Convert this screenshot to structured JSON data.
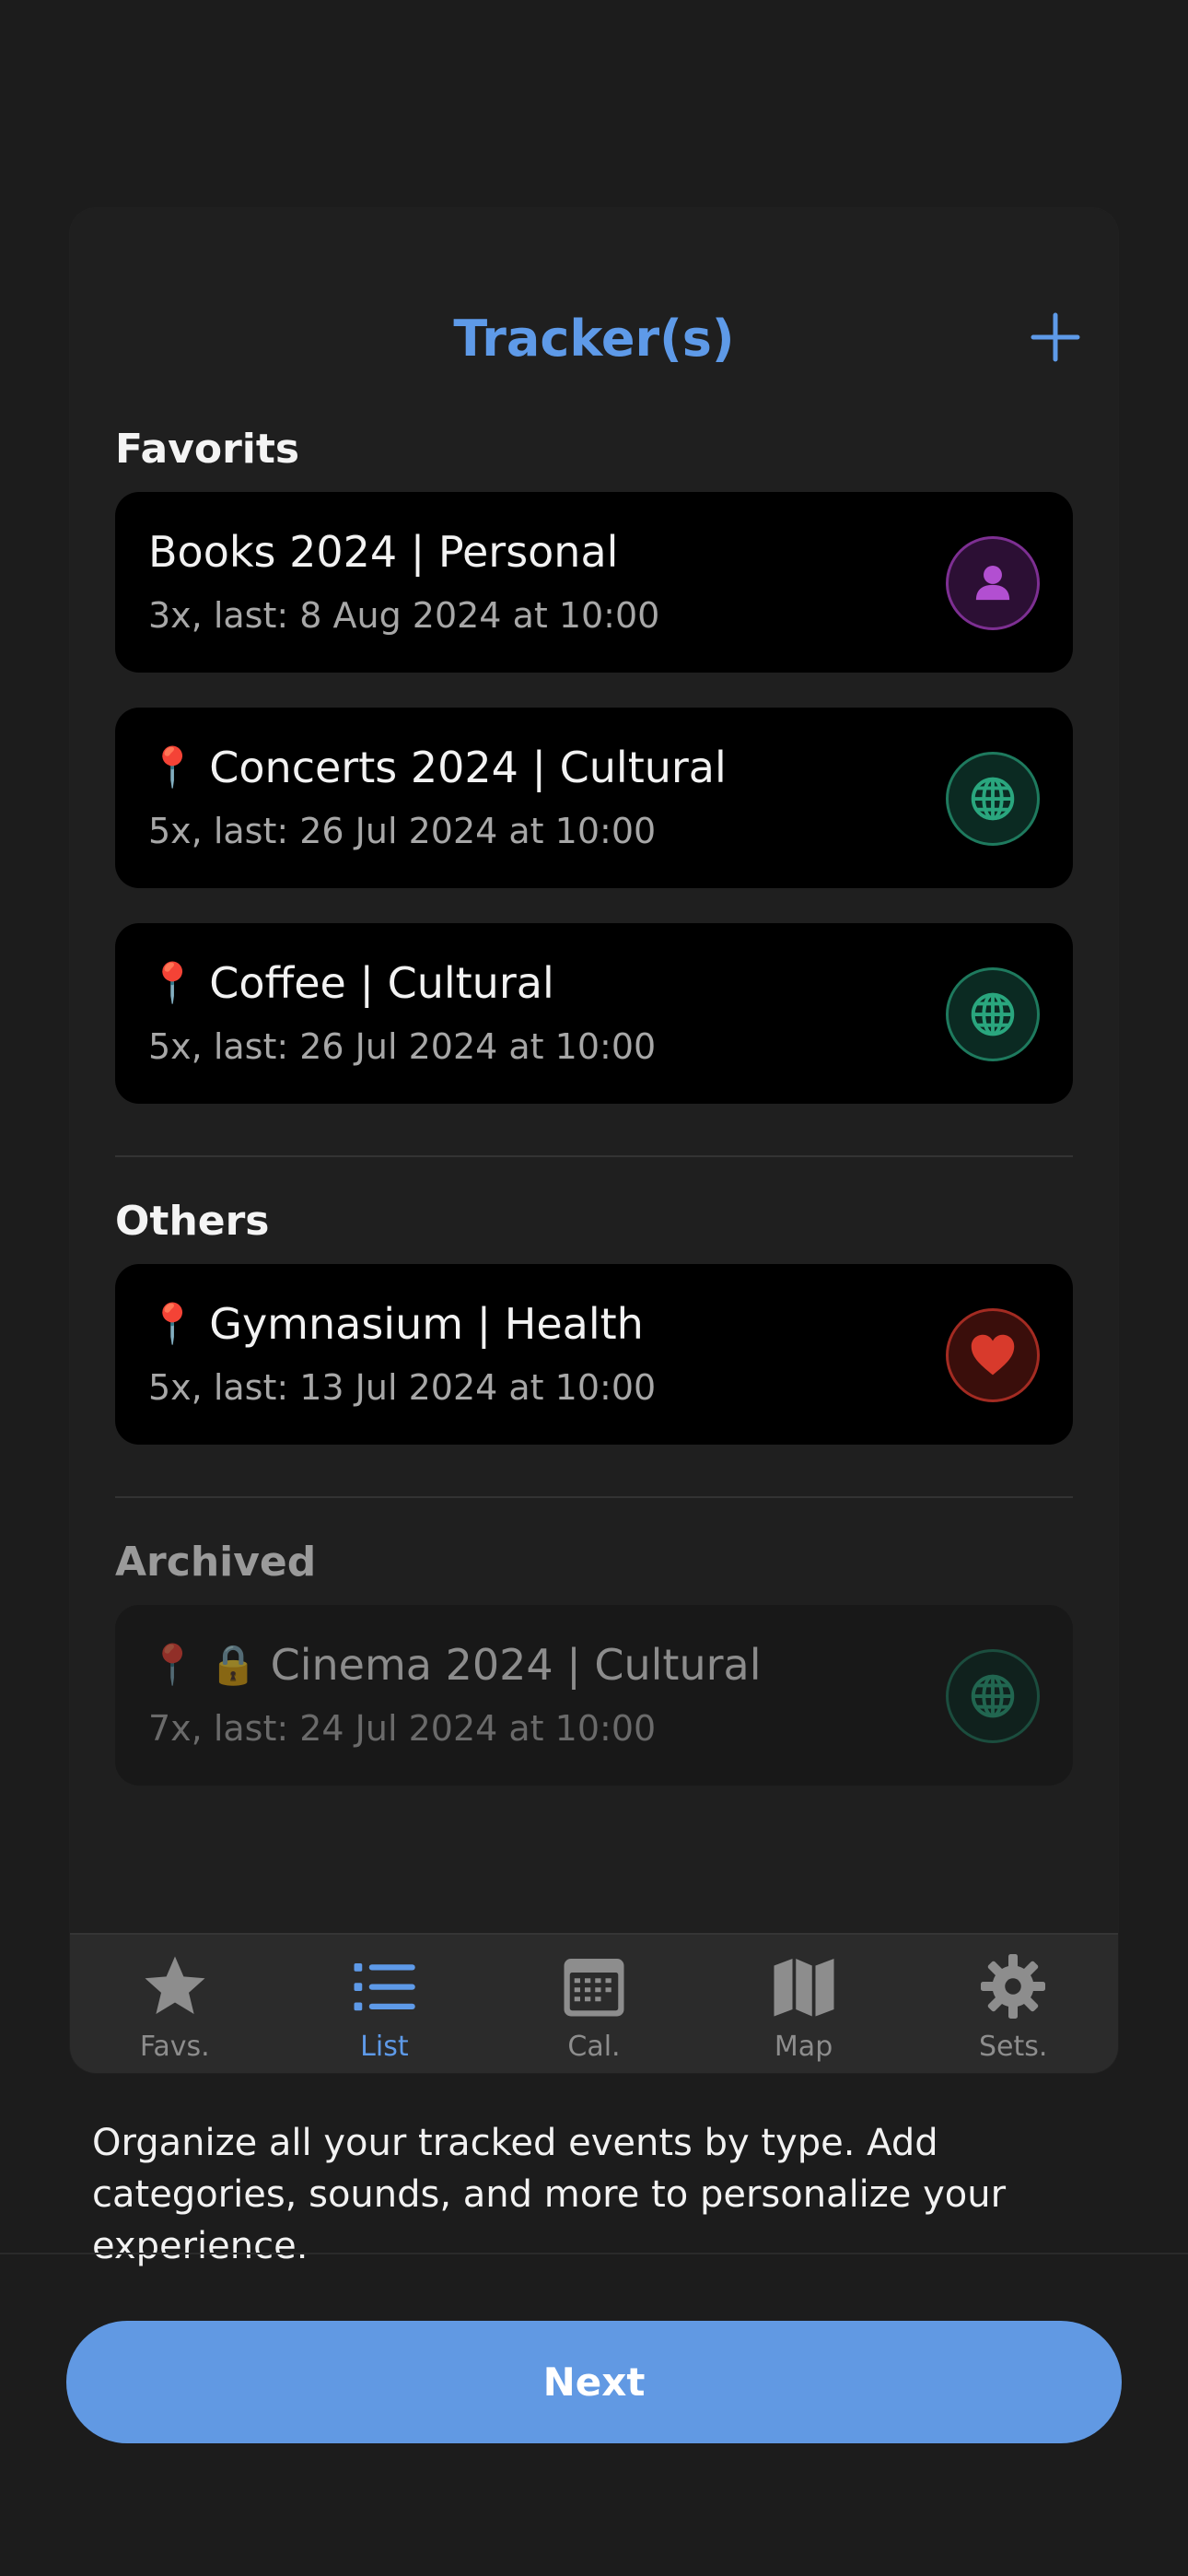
{
  "header": {
    "title": "Tracker(s)"
  },
  "sections": {
    "favorites": "Favorits",
    "others": "Others",
    "archived": "Archived"
  },
  "trackers": [
    {
      "name": "Books 2024 | Personal",
      "meta": "3x, last: 8 Aug 2024 at 10:00",
      "icon": "person-icon",
      "color": "#b24fd1",
      "pin": false,
      "lock": false
    },
    {
      "name": "Concerts 2024 | Cultural",
      "meta": "5x, last: 26 Jul 2024 at 10:00",
      "icon": "globe-icon",
      "color": "#2aa67e",
      "pin": true,
      "lock": false
    },
    {
      "name": "Coffee | Cultural",
      "meta": "5x, last: 26 Jul 2024 at 10:00",
      "icon": "globe-icon",
      "color": "#2aa67e",
      "pin": true,
      "lock": false
    },
    {
      "name": "Gymnasium | Health",
      "meta": "5x, last: 13 Jul 2024 at 10:00",
      "icon": "heart-icon",
      "color": "#d83a2c",
      "pin": true,
      "lock": false
    },
    {
      "name": "Cinema 2024 | Cultural",
      "meta": "7x, last: 24 Jul 2024 at 10:00",
      "icon": "globe-icon",
      "color": "#2aa67e",
      "pin": true,
      "lock": true
    }
  ],
  "tabs": [
    {
      "label": "Favs.",
      "icon": "star-icon",
      "active": false
    },
    {
      "label": "List",
      "icon": "list-icon",
      "active": true
    },
    {
      "label": "Cal.",
      "icon": "calendar-icon",
      "active": false
    },
    {
      "label": "Map",
      "icon": "map-icon",
      "active": false
    },
    {
      "label": "Sets.",
      "icon": "gear-icon",
      "active": false
    }
  ],
  "description": "Organize all your tracked events by type. Add categories, sounds, and more to personalize your experience.",
  "next_label": "Next",
  "colors": {
    "accent": "#5e9ae8",
    "button": "#6199e3"
  }
}
